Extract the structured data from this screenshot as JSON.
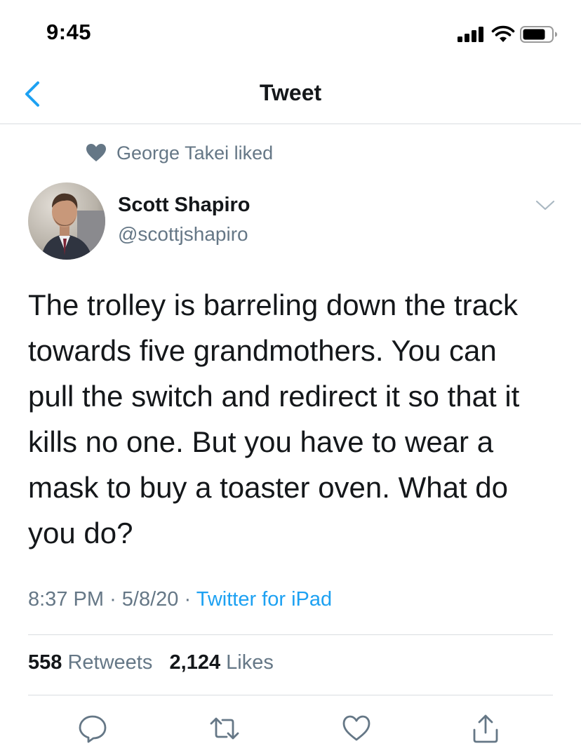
{
  "status_bar": {
    "time": "9:45",
    "icons": [
      "cellular-signal-icon",
      "wifi-icon",
      "battery-icon"
    ]
  },
  "nav": {
    "back_icon": "chevron-left-icon",
    "title": "Tweet"
  },
  "social_context": {
    "icon": "heart-icon",
    "text": "George Takei liked"
  },
  "tweet": {
    "author_name": "Scott Shapiro",
    "author_handle": "@scottjshapiro",
    "more_icon": "chevron-down-icon",
    "text": "The trolley is barreling down the track\ntowards five grandmothers. You can\npull the switch and redirect it so that it\nkills no one. But you have to wear a\nmask to buy a toaster oven. What do\nyou do?",
    "time": "8:37 PM",
    "date": "5/8/20",
    "separator": "·",
    "source": "Twitter for iPad"
  },
  "stats": {
    "retweets_count": "558",
    "retweets_label": "Retweets",
    "likes_count": "2,124",
    "likes_label": "Likes"
  },
  "actions": [
    "reply-icon",
    "retweet-icon",
    "like-icon",
    "share-icon"
  ],
  "colors": {
    "accent": "#1da1f2",
    "secondary_text": "#657786",
    "primary_text": "#14171a",
    "divider": "#d9dde0",
    "nav_back": "#1da1f2"
  }
}
